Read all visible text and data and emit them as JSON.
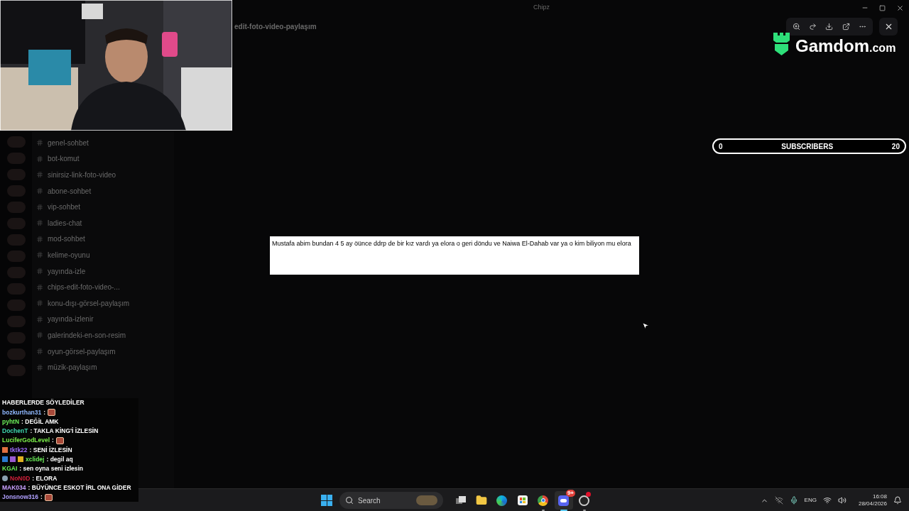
{
  "discord": {
    "title": "Chipz",
    "channel_header": "edit-foto-video-paylaşım",
    "channels": [
      {
        "name": "genel-sohbet"
      },
      {
        "name": "bot-komut"
      },
      {
        "name": "sinirsiz-link-foto-video"
      },
      {
        "name": "abone-sohbet"
      },
      {
        "name": "vip-sohbet"
      },
      {
        "name": "ladies-chat"
      },
      {
        "name": "mod-sohbet"
      },
      {
        "name": "kelime-oyunu"
      },
      {
        "name": "yayında-izle"
      },
      {
        "name": "chips-edit-foto-video-..."
      },
      {
        "name": "konu-dışı-görsel-paylaşım"
      },
      {
        "name": "yayında-izlenir"
      },
      {
        "name": "galerindeki-en-son-resim"
      },
      {
        "name": "oyun-görsel-paylaşım"
      },
      {
        "name": "müzik-paylaşım"
      }
    ]
  },
  "chat": [
    {
      "text": "HABERLERDE SÖYLEDİLER",
      "emote": false
    },
    {
      "user": "bozkurthan31",
      "color": "#8fb8ff",
      "text": ":",
      "emote": true
    },
    {
      "user": "pyhtN",
      "color": "#6cf05a",
      "text": ": DEĞİL AMK",
      "emote": false
    },
    {
      "user": "DochenT",
      "color": "#3fd6b0",
      "text": ": TAKLA KİNG'İ İZLESİN",
      "emote": false
    },
    {
      "user": "LuciferGodLevel",
      "color": "#7cf04a",
      "text": ":",
      "emote": true
    },
    {
      "user": "tktk22",
      "color": "#a070ff",
      "text": ": SENİ İZLESİN",
      "emote": false,
      "badges": [
        {
          "kind": "bits"
        }
      ]
    },
    {
      "user": "xclidej",
      "color": "#6cf05a",
      "text": ": degil aq",
      "emote": false,
      "badges": [
        {
          "kind": "tile"
        },
        {
          "kind": "gem"
        },
        {
          "kind": "crown"
        }
      ]
    },
    {
      "user": "KGAI",
      "color": "#6cf05a",
      "text": ": sen oyna seni izlesin",
      "emote": false
    },
    {
      "user": "NoN0D",
      "color": "#d0203a",
      "text": ": ELORA",
      "emote": false,
      "badges": [
        {
          "kind": "globe"
        }
      ]
    },
    {
      "user": "MAK034",
      "color": "#c8a0ff",
      "text": ": BÜYÜNCE ESKOT İRL ONA GİDER",
      "emote": false
    },
    {
      "user": "Jonsnow316",
      "color": "#b0a0ff",
      "text": ":",
      "emote": true
    }
  ],
  "donation": {
    "message": "Mustafa abim  bundan 4 5 ay öünce ddrp de bir kız vardı ya elora o geri döndu ve Naiwa El-Dahab var ya o kim biliyon mu elora"
  },
  "subscribers": {
    "current": "0",
    "label": "SUBSCRIBERS",
    "goal": "20"
  },
  "sponsor": {
    "name": "Gamdom",
    "suffix": ".com"
  },
  "taskbar": {
    "search": "Search",
    "apps": [
      {
        "kind": "taskview",
        "open": false,
        "focused": false
      },
      {
        "kind": "files",
        "open": false,
        "focused": false
      },
      {
        "kind": "edge",
        "open": false,
        "focused": false
      },
      {
        "kind": "store",
        "open": false,
        "focused": false
      },
      {
        "kind": "chrome",
        "open": true,
        "focused": false
      },
      {
        "kind": "discord",
        "open": true,
        "focused": true,
        "badge": "9+"
      },
      {
        "kind": "obs",
        "open": true,
        "focused": false,
        "alert": true
      }
    ],
    "language": "ENG",
    "time": "16:08",
    "date": "28/04/2026"
  }
}
